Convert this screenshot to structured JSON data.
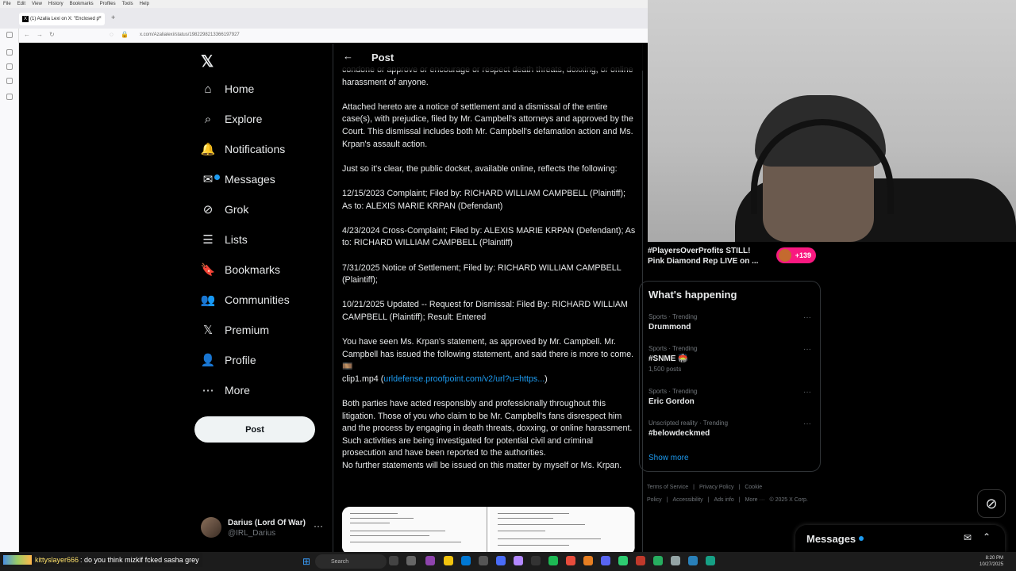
{
  "browser": {
    "menu": [
      "File",
      "Edit",
      "View",
      "History",
      "Bookmarks",
      "Profiles",
      "Tools",
      "Help"
    ],
    "tab_title": "(1) Azalia Lexi on X: \"Enclosed p",
    "url": "x.com/Azalialexi/status/1982298213366197927"
  },
  "nav": {
    "items": [
      {
        "label": "Home",
        "icon": "home-icon"
      },
      {
        "label": "Explore",
        "icon": "search-icon"
      },
      {
        "label": "Notifications",
        "icon": "bell-icon"
      },
      {
        "label": "Messages",
        "icon": "mail-icon"
      },
      {
        "label": "Grok",
        "icon": "grok-icon"
      },
      {
        "label": "Lists",
        "icon": "list-icon"
      },
      {
        "label": "Bookmarks",
        "icon": "bookmark-icon"
      },
      {
        "label": "Communities",
        "icon": "people-icon"
      },
      {
        "label": "Premium",
        "icon": "x-icon"
      },
      {
        "label": "Profile",
        "icon": "person-icon"
      },
      {
        "label": "More",
        "icon": "more-icon"
      }
    ],
    "post_button": "Post"
  },
  "account": {
    "name": "Darius (Lord Of War)",
    "handle": "@IRL_Darius"
  },
  "post": {
    "header": "Post",
    "paragraphs": [
      "condone or approve or encourage or respect death threats, doxxing, or online harassment of anyone.",
      "Attached hereto are a notice of settlement and a dismissal of the entire case(s), with prejudice, filed by Mr. Campbell's attorneys and approved by the Court.  This dismissal includes both Mr. Campbell's defamation action and Ms. Krpan's assault action.",
      "Just so it's clear, the public docket, available online, reflects the following:",
      "12/15/2023  Complaint; Filed by: RICHARD WILLIAM CAMPBELL (Plaintiff); As to: ALEXIS MARIE KRPAN (Defendant)",
      "4/23/2024   Cross-Complaint; Filed by: ALEXIS MARIE KRPAN (Defendant); As to: RICHARD WILLIAM CAMPBELL (Plaintiff)",
      "7/31/2025   Notice of Settlement; Filed by: RICHARD WILLIAM CAMPBELL (Plaintiff);",
      "10/21/2025  Updated -- Request for Dismissal: Filed By: RICHARD WILLIAM CAMPBELL (Plaintiff); Result: Entered"
    ],
    "statement_text": "You have seen Ms. Krpan's statement, as approved by Mr. Campbell.  Mr. Campbell has issued the following statement, and said there is more to come. 🎞️\nclip1.mp4 (",
    "statement_link": "urldefense.proofpoint.com/v2/url?u=https...",
    "statement_close": ")",
    "closing": "Both parties have acted responsibly and professionally throughout this litigation.  Those of you who claim to be Mr. Campbell's fans disrespect him and the process by engaging in death threats, doxxing, or online harassment.  Such activities are being investigated for potential civil and criminal prosecution and have been reported to the authorities.\nNo further statements will be issued on this matter by myself or Ms. Krpan."
  },
  "live_card": {
    "text": "#PlayersOverProfits STILL! Pink Diamond Rep LIVE on ...",
    "badge": "+139"
  },
  "happening": {
    "title": "What's happening",
    "trends": [
      {
        "meta": "Sports · Trending",
        "name": "Drummond",
        "count": ""
      },
      {
        "meta": "Sports · Trending",
        "name": "#SNME 🏟️",
        "count": "1,500 posts"
      },
      {
        "meta": "Sports · Trending",
        "name": "Eric Gordon",
        "count": ""
      },
      {
        "meta": "Unscripted reality · Trending",
        "name": "#belowdeckmed",
        "count": ""
      }
    ],
    "show_more": "Show more"
  },
  "footer": {
    "links": [
      "Terms of Service",
      "|",
      "Privacy Policy",
      "|",
      "Cookie Policy",
      "|",
      "Accessibility",
      "|",
      "Ads info",
      "|",
      "More ···",
      "© 2025 X Corp."
    ]
  },
  "messages_drawer": {
    "title": "Messages"
  },
  "chat": {
    "user": "kittyslayer666",
    "message": ": do you think mizkif fcked sasha grey"
  },
  "taskbar": {
    "search_placeholder": "Search",
    "time": "8:20 PM",
    "date": "10/27/2025"
  },
  "colors": {
    "accent": "#1d9bf0",
    "live_badge": "#f91880",
    "background": "#000000",
    "border": "#2f3336"
  }
}
